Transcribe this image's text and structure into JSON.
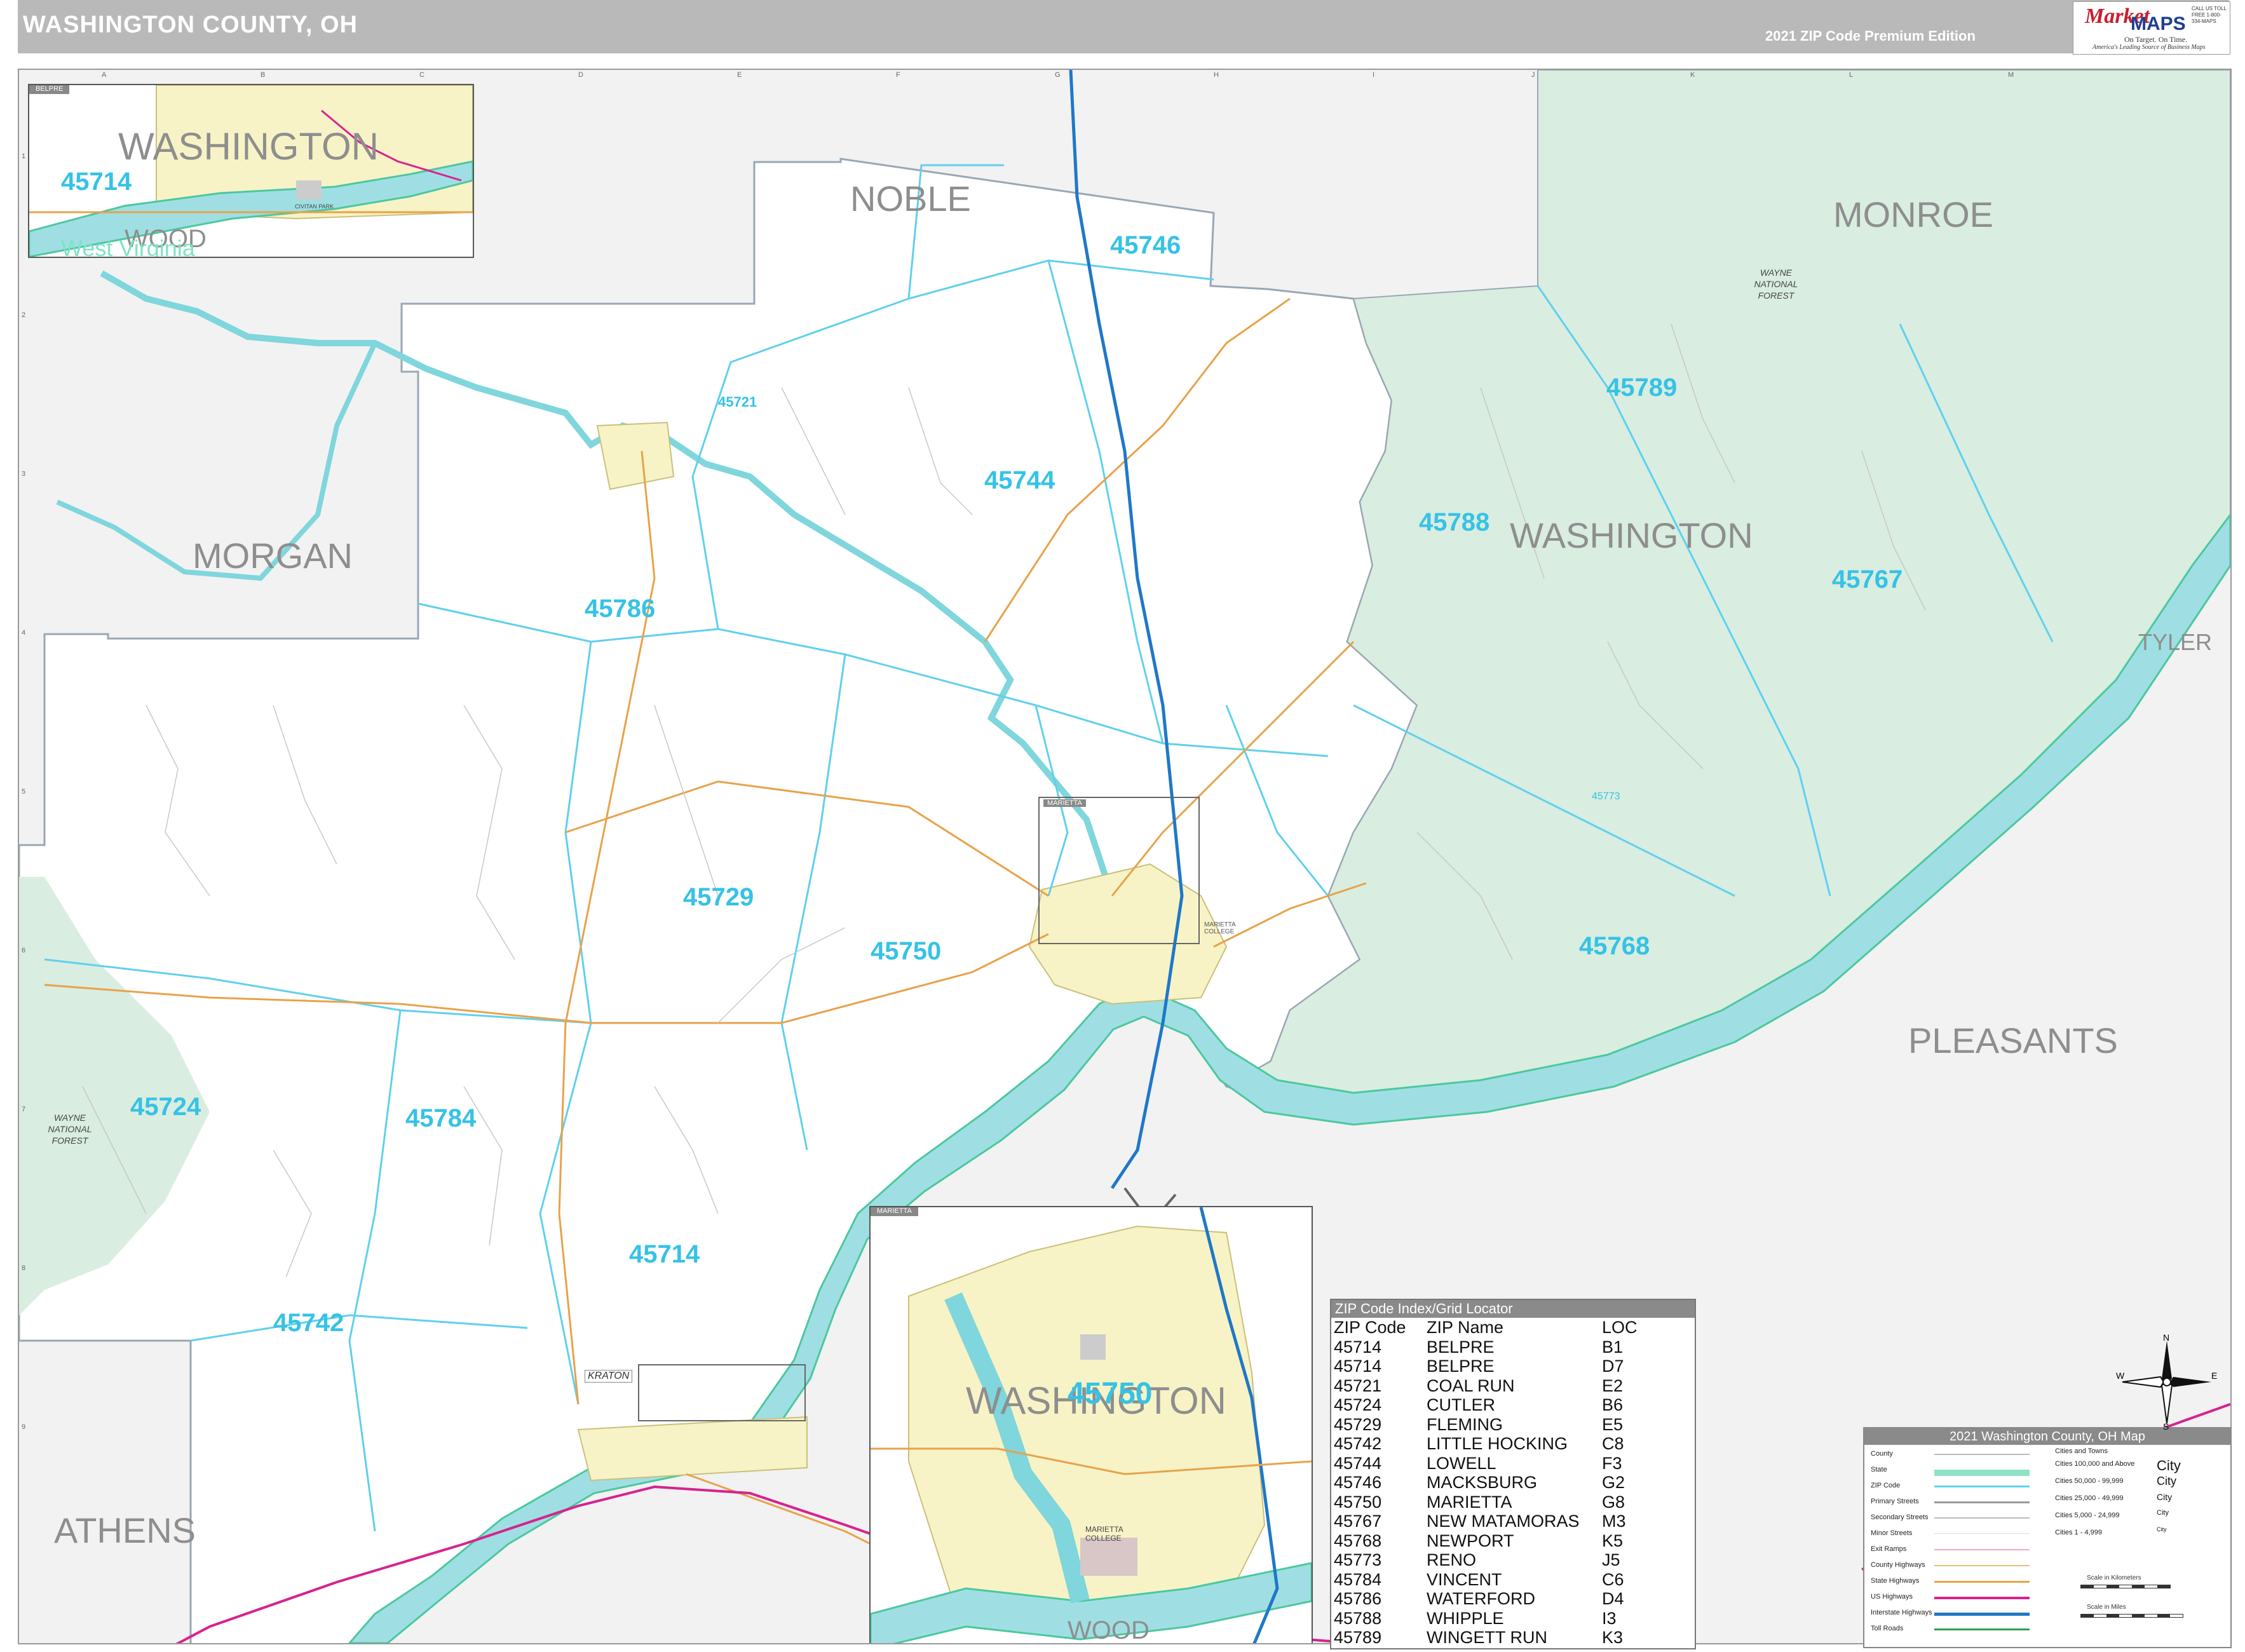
{
  "header": {
    "title": "WASHINGTON COUNTY, OH",
    "edition": "2021 ZIP Code Premium Edition"
  },
  "logo": {
    "brand_a": "Market",
    "brand_b": "MAPS",
    "tagline": "On Target. On Time.",
    "subtitle": "America's Leading Source of Business Maps",
    "contact": "CALL US TOLL FREE 1-800-334-MAPS"
  },
  "counties": {
    "noble": "NOBLE",
    "monroe": "MONROE",
    "morgan": "MORGAN",
    "washington": "WASHINGTON",
    "tyler": "TYLER",
    "pleasants": "PLEASANTS",
    "athens": "ATHENS",
    "wood": "WOOD"
  },
  "forests": {
    "wayne_east": "WAYNE NATIONAL FOREST",
    "wayne_west": "WAYNE NATIONAL FOREST"
  },
  "zips_on_map": {
    "z45746": "45746",
    "z45721": "45721",
    "z45744": "45744",
    "z45789": "45789",
    "z45788": "45788",
    "z45767": "45767",
    "z45786": "45786",
    "z45729": "45729",
    "z45750": "45750",
    "z45768": "45768",
    "z45773": "45773",
    "z45724": "45724",
    "z45784": "45784",
    "z45714": "45714",
    "z45742": "45742"
  },
  "places": {
    "kraton": "KRATON",
    "marietta_tab": "MARIETTA",
    "marietta_college": "MARIETTA COLLEGE",
    "civitan_park": "CIVITAN PARK",
    "belpre_tab": "BELPRE"
  },
  "inset_belpre": {
    "county": "WASHINGTON",
    "zip": "45714",
    "wood": "WOOD",
    "wv": "West Virginia"
  },
  "inset_marietta": {
    "county": "WASHINGTON",
    "zip": "45750",
    "wood": "WOOD"
  },
  "zip_index": {
    "title": "ZIP Code Index/Grid Locator",
    "headers": [
      "ZIP Code",
      "ZIP Name",
      "LOC"
    ],
    "rows": [
      [
        "45714",
        "BELPRE",
        "B1"
      ],
      [
        "45714",
        "BELPRE",
        "D7"
      ],
      [
        "45721",
        "COAL RUN",
        "E2"
      ],
      [
        "45724",
        "CUTLER",
        "B6"
      ],
      [
        "45729",
        "FLEMING",
        "E5"
      ],
      [
        "45742",
        "LITTLE HOCKING",
        "C8"
      ],
      [
        "45744",
        "LOWELL",
        "F3"
      ],
      [
        "45746",
        "MACKSBURG",
        "G2"
      ],
      [
        "45750",
        "MARIETTA",
        "G8"
      ],
      [
        "45767",
        "NEW MATAMORAS",
        "M3"
      ],
      [
        "45768",
        "NEWPORT",
        "K5"
      ],
      [
        "45773",
        "RENO",
        "J5"
      ],
      [
        "45784",
        "VINCENT",
        "C6"
      ],
      [
        "45786",
        "WATERFORD",
        "D4"
      ],
      [
        "45788",
        "WHIPPLE",
        "I3"
      ],
      [
        "45789",
        "WINGETT RUN",
        "K3"
      ]
    ]
  },
  "legend": {
    "title": "2021 Washington County, OH Map",
    "items": [
      "County",
      "State",
      "ZIP Code",
      "Primary Streets",
      "Secondary Streets",
      "Minor Streets",
      "Exit Ramps",
      "County Highways",
      "State Highways",
      "US Highways",
      "Interstate Highways",
      "Toll Roads"
    ],
    "city_header": "Cities and Towns",
    "city_tiers": [
      {
        "range": "Cities 100,000 and Above",
        "sample": "City"
      },
      {
        "range": "Cities 50,000 - 99,999",
        "sample": "City"
      },
      {
        "range": "Cities 25,000 - 49,999",
        "sample": "City"
      },
      {
        "range": "Cities 5,000 - 24,999",
        "sample": "City"
      },
      {
        "range": "Cities 1 - 4,999",
        "sample": "City"
      }
    ],
    "scale_km": "Scale in Kilometers",
    "scale_mi": "Scale in Miles"
  },
  "compass": {
    "n": "N",
    "s": "S",
    "e": "E",
    "w": "W"
  },
  "grid": {
    "cols": [
      "A",
      "B",
      "C",
      "D",
      "E",
      "F",
      "G",
      "H",
      "I",
      "J",
      "K",
      "L",
      "M"
    ],
    "rows": [
      "1",
      "2",
      "3",
      "4",
      "5",
      "6",
      "7",
      "8",
      "9"
    ]
  },
  "colors": {
    "zip_label": "#36c2e6",
    "zip_line": "#5fd0ee",
    "forest": "#d9ede0",
    "river": "#9fdfe3",
    "river_edge": "#4cc79f",
    "interstate": "#1f78c8",
    "us_highway": "#d6238f",
    "state_highway": "#e8a24a",
    "city_fill": "#f7f3c6",
    "county_line": "#9aa7b3"
  }
}
